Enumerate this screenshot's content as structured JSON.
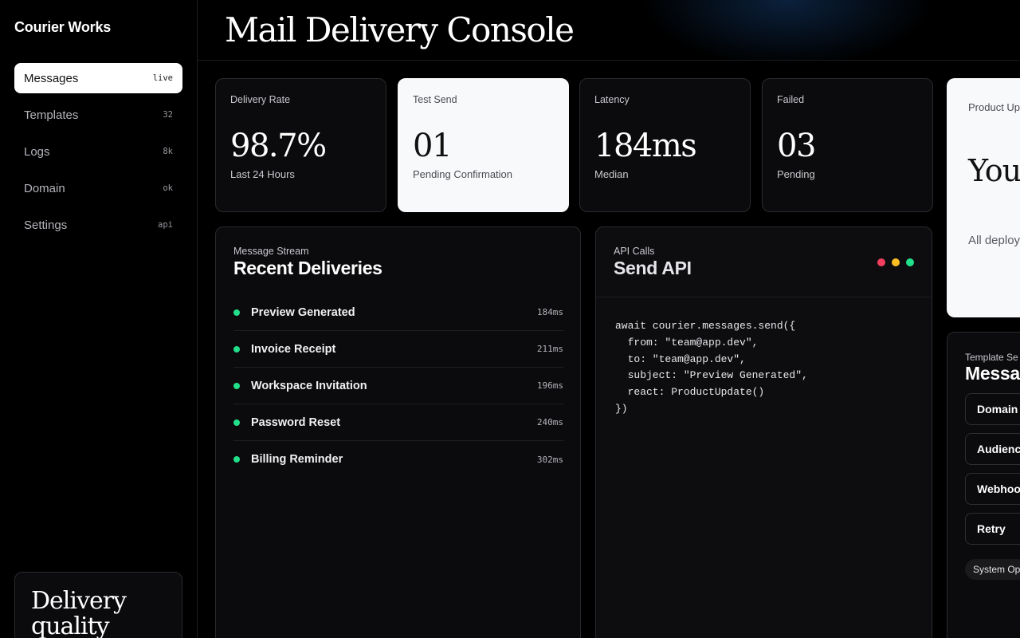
{
  "app": {
    "brand": "Courier Works"
  },
  "sidebar": {
    "items": [
      {
        "label": "Messages",
        "badge": "live",
        "active": true
      },
      {
        "label": "Templates",
        "badge": "32"
      },
      {
        "label": "Logs",
        "badge": "8k"
      },
      {
        "label": "Domain",
        "badge": "ok"
      },
      {
        "label": "Settings",
        "badge": "api"
      }
    ],
    "promo_title": "Delivery quality"
  },
  "header": {
    "title": "Mail Delivery Console"
  },
  "stats": [
    {
      "label": "Delivery Rate",
      "value": "98.7%",
      "sub": "Last 24 Hours"
    },
    {
      "label": "Test Send",
      "value": "01",
      "sub": "Pending Confirmation"
    },
    {
      "label": "Latency",
      "value": "184ms",
      "sub": "Median"
    },
    {
      "label": "Failed",
      "value": "03",
      "sub": "Pending"
    }
  ],
  "deliveries": {
    "eyebrow": "Message Stream",
    "title": "Recent Deliveries",
    "rows": [
      {
        "name": "Preview Generated",
        "time": "184ms"
      },
      {
        "name": "Invoice Receipt",
        "time": "211ms"
      },
      {
        "name": "Workspace Invitation",
        "time": "196ms"
      },
      {
        "name": "Password Reset",
        "time": "240ms"
      },
      {
        "name": "Billing Reminder",
        "time": "302ms"
      }
    ],
    "status_color": "#22e08a"
  },
  "api": {
    "eyebrow": "API Calls",
    "title": "Send API",
    "window_dots": [
      "#f43f5e",
      "#fbbf24",
      "#22e08a"
    ],
    "code": "await courier.messages.send({\n  from: \"team@app.dev\",\n  to: \"team@app.dev\",\n  subject: \"Preview Generated\",\n  react: ProductUpdate()\n})"
  },
  "product_update": {
    "eyebrow": "Product Up",
    "headline": "You been",
    "description": "All deploy summary"
  },
  "template_settings": {
    "eyebrow": "Template Se",
    "title": "Messag",
    "rows": [
      "Domain",
      "Audienc",
      "Webhoo",
      "Retry"
    ],
    "chip": "System Op"
  }
}
